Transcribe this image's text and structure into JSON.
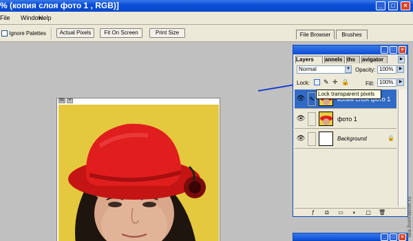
{
  "title": "% (копия слоя фото 1 , RGB)]",
  "menu": [
    "File",
    "Window",
    "Help"
  ],
  "options": {
    "ignore_palettes": "Ignore Palettes",
    "actual_pixels": "Actual Pixels",
    "fit_on_screen": "Fit On Screen",
    "print_size": "Print Size"
  },
  "well_tabs": [
    "File Browser",
    "Brushes"
  ],
  "document": {
    "zoom_label": "01"
  },
  "layers_palette": {
    "tabs": [
      "Layers",
      "Channels",
      "Paths",
      "Navigator"
    ],
    "tab_labels_visible": [
      "Layers",
      "annels",
      "ths",
      "avigator"
    ],
    "blend_mode": "Normal",
    "opacity_label": "Opacity:",
    "opacity_value": "100%",
    "lock_label": "Lock:",
    "fill_label": "Fill:",
    "fill_value": "100%",
    "tooltip": "Lock transparent pixels",
    "layers": [
      {
        "name": "копия слоя фото 1",
        "selected": true
      },
      {
        "name": "фото 1",
        "selected": false
      },
      {
        "name": "Background",
        "selected": false
      }
    ]
  },
  "watermark": "sila.livemaster.ru",
  "colors": {
    "title_blue": "#0a4ed8",
    "selection_blue": "#316ac5",
    "arrow_blue": "#1a3fd1",
    "hat_red": "#e01e1e"
  }
}
